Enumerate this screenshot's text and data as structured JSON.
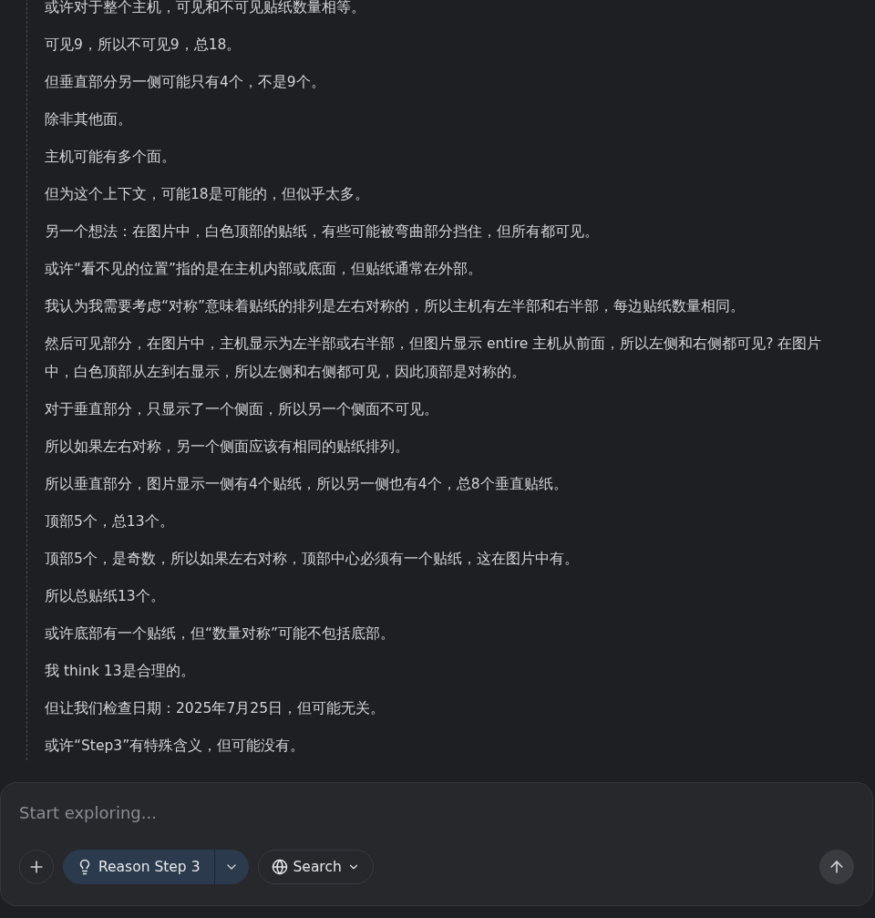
{
  "thinking": {
    "paragraphs": [
      "或许对于整个主机，可见和不可见贴纸数量相等。",
      "可见9，所以不可见9，总18。",
      "但垂直部分另一侧可能只有4个，不是9个。",
      "除非其他面。",
      "主机可能有多个面。",
      "但为这个上下文，可能18是可能的，但似乎太多。",
      "另一个想法：在图片中，白色顶部的贴纸，有些可能被弯曲部分挡住，但所有都可见。",
      "或许“看不见的位置”指的是在主机内部或底面，但贴纸通常在外部。",
      "我认为我需要考虑“对称”意味着贴纸的排列是左右对称的，所以主机有左半部和右半部，每边贴纸数量相同。",
      "然后可见部分，在图片中，主机显示为左半部或右半部，但图片显示 entire 主机从前面，所以左侧和右侧都可见? 在图片中，白色顶部从左到右显示，所以左侧和右侧都可见，因此顶部是对称的。",
      "对于垂直部分，只显示了一个侧面，所以另一个侧面不可见。",
      "所以如果左右对称，另一个侧面应该有相同的贴纸排列。",
      "所以垂直部分，图片显示一侧有4个贴纸，所以另一侧也有4个，总8个垂直贴纸。",
      "顶部5个，总13个。",
      "顶部5个，是奇数，所以如果左右对称，顶部中心必须有一个贴纸，这在图片中有。",
      "所以总贴纸13个。",
      "或许底部有一个贴纸，但“数量对称”可能不包括底部。",
      "我 think 13是合理的。",
      "但让我们检查日期：2025年7月25日，但可能无关。",
      "或许“Step3”有特殊含义，但可能没有。"
    ]
  },
  "composer": {
    "placeholder": "Start exploring...",
    "mode_button": {
      "label": "Reason Step 3",
      "selected": true
    },
    "search_button": {
      "label": "Search",
      "selected": false
    }
  }
}
